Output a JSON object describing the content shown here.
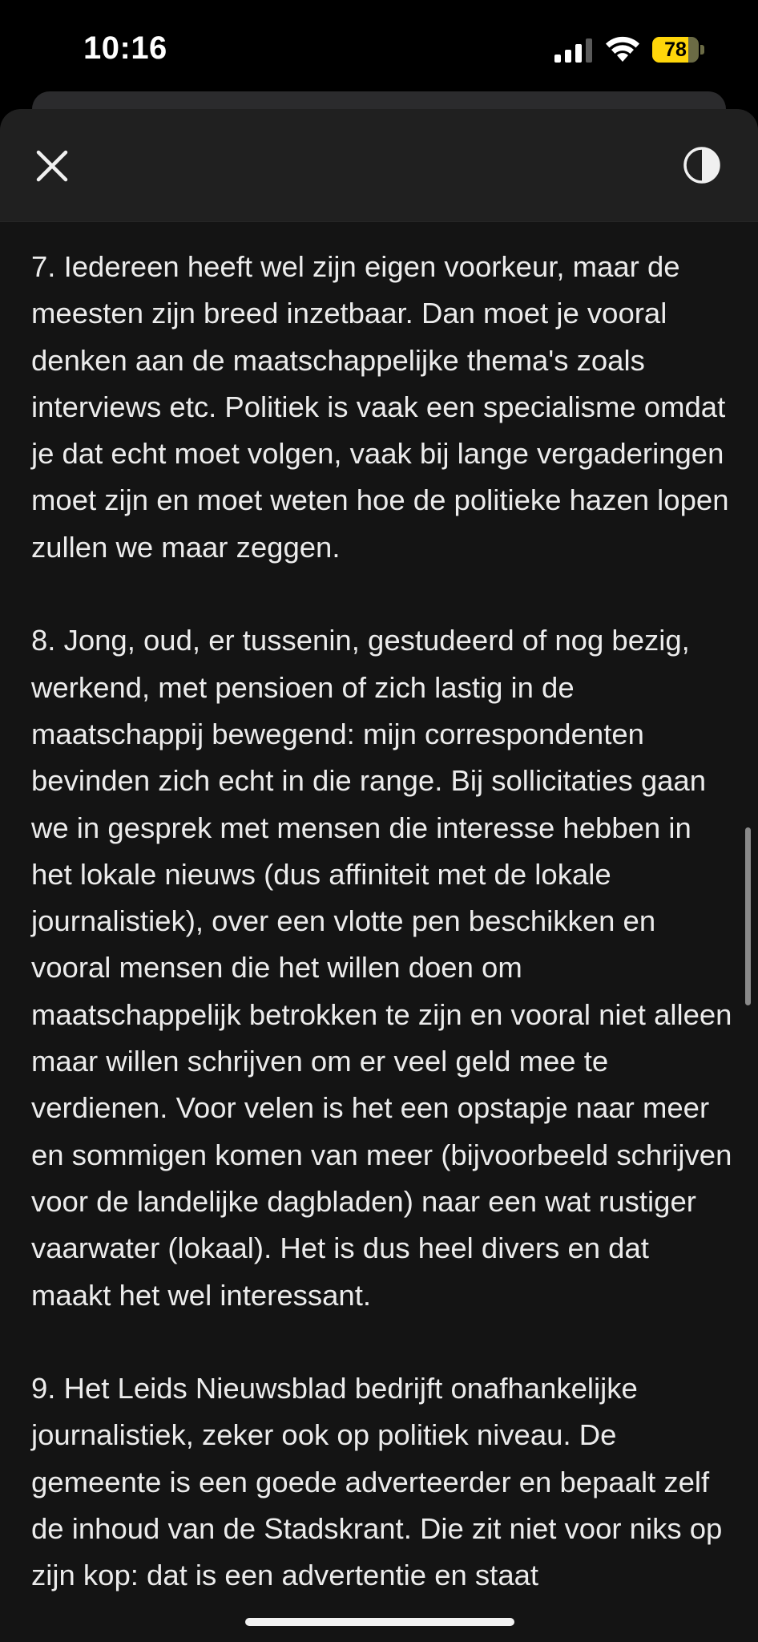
{
  "status_bar": {
    "time": "10:16",
    "battery_level": "78",
    "battery_fraction": 0.78,
    "signal_icon": "cellular-signal-icon",
    "wifi_icon": "wifi-icon"
  },
  "toolbar": {
    "close_icon": "close-icon",
    "appearance_icon": "contrast-icon"
  },
  "article": {
    "paragraphs": [
      "7. Iedereen heeft wel zijn eigen voorkeur, maar de meesten zijn breed inzetbaar. Dan moet je vooral denken aan de maatschappelijke thema's zoals interviews etc. Politiek is vaak een specialisme omdat je dat echt moet volgen, vaak bij lange vergaderingen moet zijn en moet weten hoe de politieke hazen lopen zullen we maar zeggen.",
      "8. Jong, oud, er tussenin, gestudeerd of nog bezig, werkend, met pensioen of zich lastig in de maatschappij bewegend: mijn correspondenten bevinden zich echt in die range. Bij sollicitaties gaan we in gesprek met mensen die interesse hebben in het lokale nieuws (dus affiniteit met de lokale journalistiek), over een vlotte pen beschikken en vooral mensen die het willen doen om maatschappelijk betrokken te zijn en vooral niet alleen maar willen schrijven om er veel geld mee te verdienen. Voor velen is het een opstapje naar meer en sommigen komen van meer (bijvoorbeeld schrijven voor de landelijke dagbladen) naar een wat rustiger vaarwater (lokaal). Het is dus heel divers en dat maakt het wel interessant.",
      "9. Het Leids Nieuwsblad bedrijft onafhankelijke journalistiek, zeker ook op politiek niveau. De gemeente is een goede adverteerder en bepaalt zelf de inhoud van de Stadskrant. Die zit niet voor niks op zijn kop: dat is een advertentie en staat"
    ]
  },
  "colors": {
    "background": "#000000",
    "reader_background": "#141414",
    "toolbar_background": "#202020",
    "text": "#ececec",
    "battery": "#ffd60a"
  }
}
